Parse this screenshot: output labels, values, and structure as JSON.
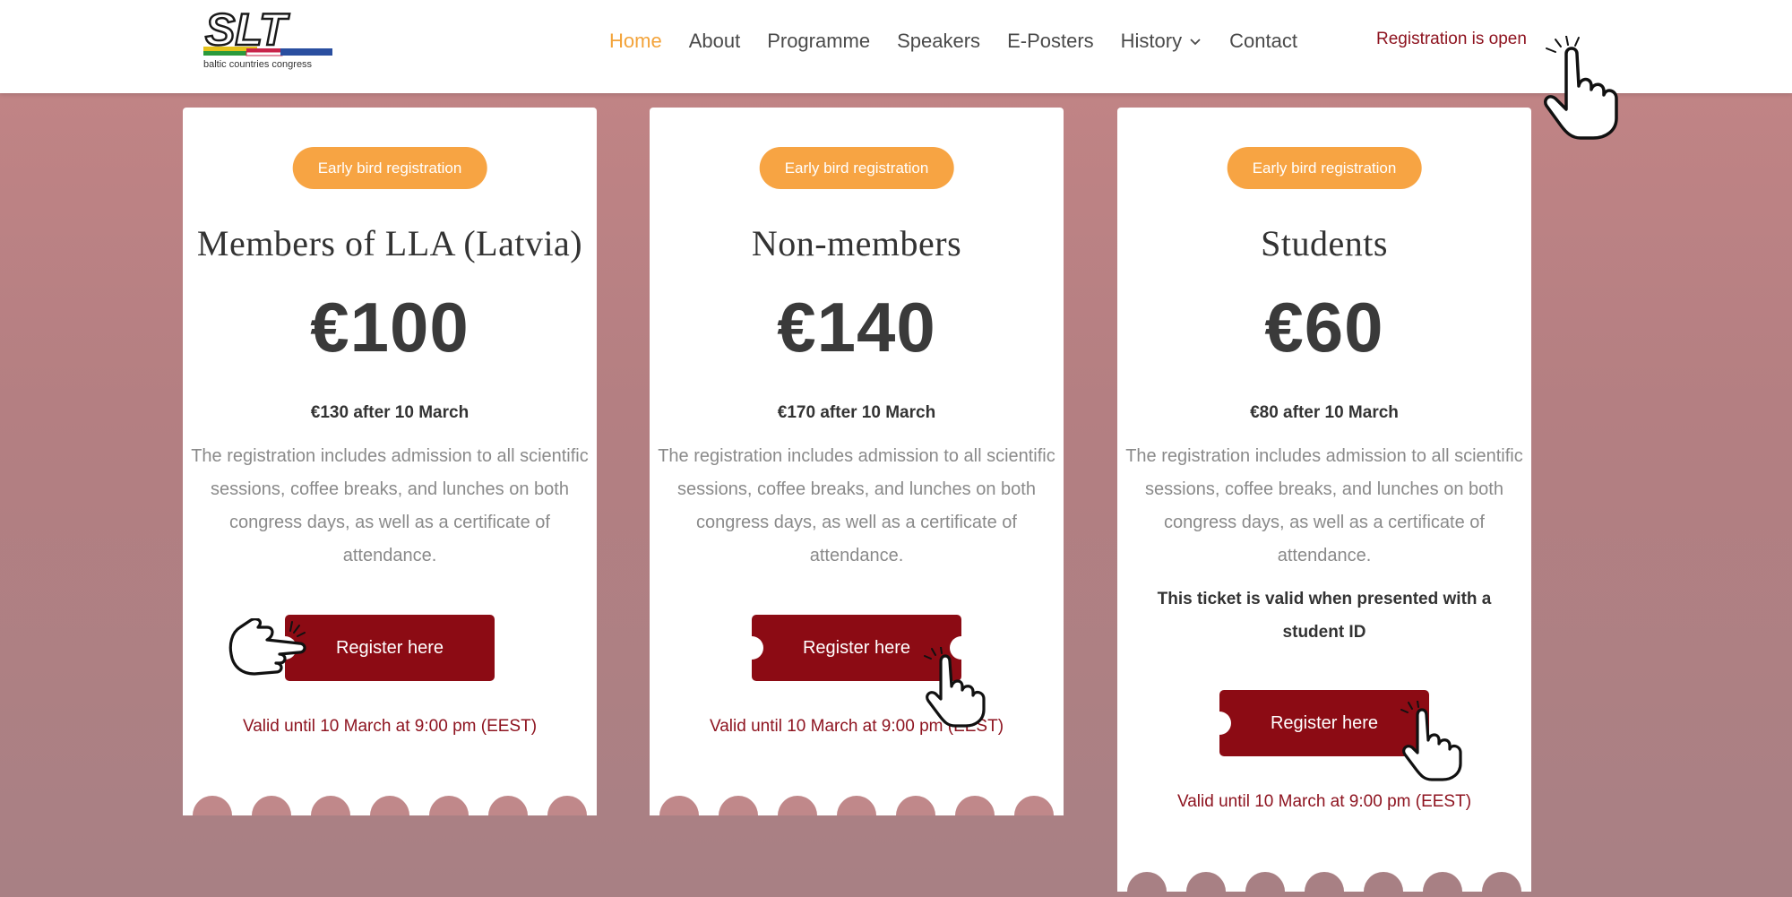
{
  "header": {
    "logo": {
      "wordmark": "SLT",
      "tagline": "baltic countries congress"
    },
    "nav": [
      {
        "label": "Home",
        "active": true
      },
      {
        "label": "About"
      },
      {
        "label": "Programme"
      },
      {
        "label": "Speakers"
      },
      {
        "label": "E-Posters"
      },
      {
        "label": "History",
        "has_dropdown": true
      },
      {
        "label": "Contact"
      }
    ],
    "registration_status": "Registration is open"
  },
  "cards": [
    {
      "badge": "Early bird registration",
      "title": "Members of LLA (Latvia)",
      "price": "€100",
      "late_price": "€130 after 10 March",
      "description": "The registration includes admission to all scientific sessions, coffee breaks, and lunches on both congress days, as well as a certificate of attendance.",
      "button": "Register here",
      "valid_until": "Valid until 10 March at 9:00 pm (EEST)"
    },
    {
      "badge": "Early bird registration",
      "title": "Non-members",
      "price": "€140",
      "late_price": "€170 after 10 March",
      "description": "The registration includes admission to all scientific sessions, coffee breaks, and lunches on both congress days, as well as a certificate of attendance.",
      "button": "Register here",
      "valid_until": "Valid until 10 March at 9:00 pm (EEST)"
    },
    {
      "badge": "Early bird registration",
      "title": "Students",
      "price": "€60",
      "late_price": "€80 after 10 March",
      "description": "The registration includes admission to all scientific sessions, coffee breaks, and lunches on both congress days, as well as a certificate of attendance.",
      "note": "This ticket is valid when presented with a student ID",
      "button": "Register here",
      "valid_until": "Valid until 10 March at 9:00 pm (EEST)"
    }
  ],
  "colors": {
    "accent": "#f3a33a",
    "badge": "#f7a443",
    "button": "#8c0b14",
    "link_red": "#8e1420",
    "background_top": "#c48586",
    "background_bottom": "#a88084"
  },
  "icons": [
    "pointing-hand-icon",
    "chevron-down-icon"
  ]
}
